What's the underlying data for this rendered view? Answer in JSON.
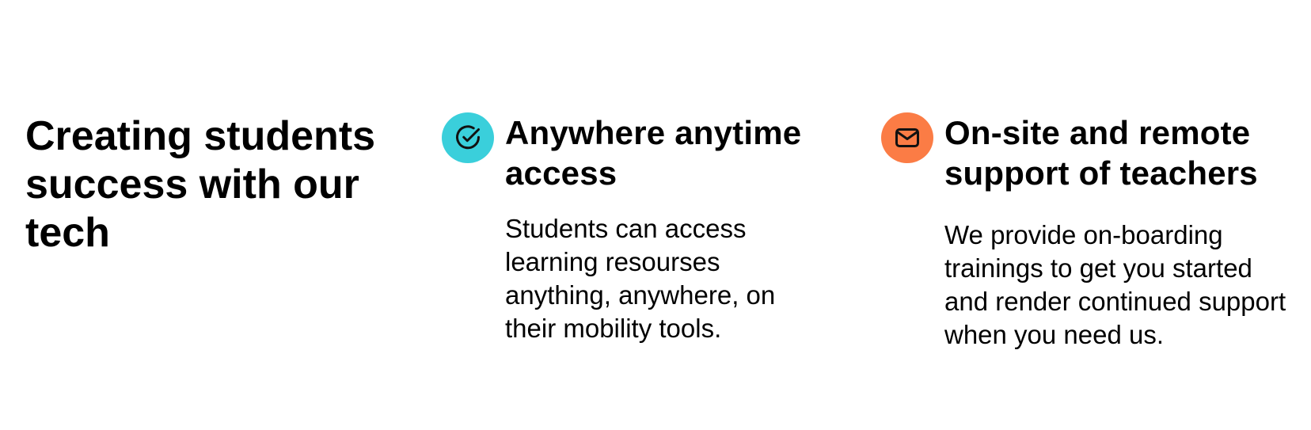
{
  "headline": "Creating students success with our tech",
  "features": [
    {
      "title": "Anywhere anytime access",
      "description": "Students can access learning resourses anything, anywhere, on their mobility tools.",
      "icon": "check-circle-icon",
      "icon_color": "#3ACFDB"
    },
    {
      "title": "On-site and remote support of teachers",
      "description": "We provide on-boarding trainings to get you started and render continued support when you need us.",
      "icon": "mail-icon",
      "icon_color": "#FB7C45"
    }
  ]
}
